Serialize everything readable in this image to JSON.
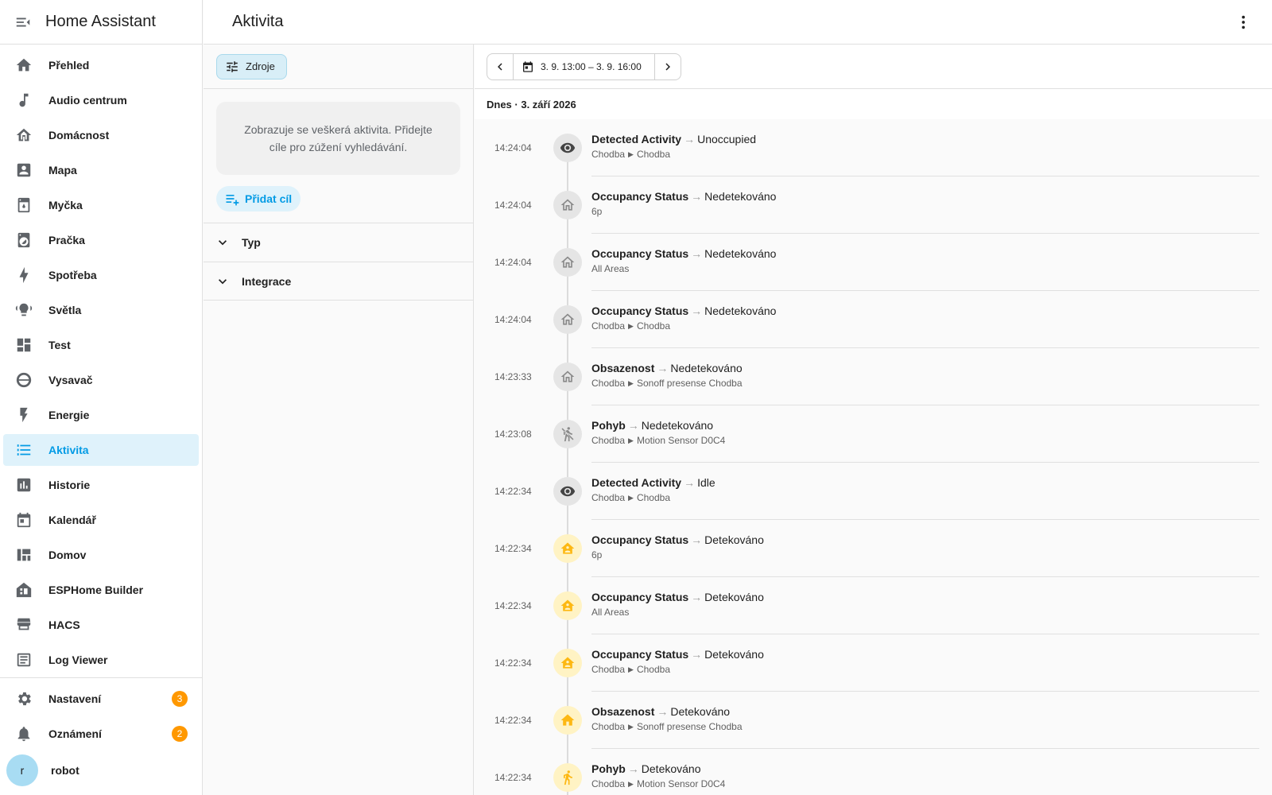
{
  "app": {
    "title": "Home Assistant"
  },
  "page": {
    "title": "Aktivita"
  },
  "sidebar": {
    "items": [
      {
        "label": "Přehled",
        "icon": "home-icon"
      },
      {
        "label": "Audio centrum",
        "icon": "music-note-icon"
      },
      {
        "label": "Domácnost",
        "icon": "home-group-icon"
      },
      {
        "label": "Mapa",
        "icon": "account-box-icon"
      },
      {
        "label": "Myčka",
        "icon": "dishwasher-icon"
      },
      {
        "label": "Pračka",
        "icon": "washing-machine-icon"
      },
      {
        "label": "Spotřeba",
        "icon": "lightning-icon"
      },
      {
        "label": "Světla",
        "icon": "lightbulb-group-icon"
      },
      {
        "label": "Test",
        "icon": "dashboard-icon"
      },
      {
        "label": "Vysavač",
        "icon": "robot-vacuum-icon"
      },
      {
        "label": "Energie",
        "icon": "flash-icon"
      },
      {
        "label": "Aktivita",
        "icon": "format-list-icon",
        "active": true
      },
      {
        "label": "Historie",
        "icon": "chart-box-icon"
      },
      {
        "label": "Kalendář",
        "icon": "calendar-icon"
      },
      {
        "label": "Domov",
        "icon": "view-dashboard-icon"
      },
      {
        "label": "ESPHome Builder",
        "icon": "esphome-icon"
      },
      {
        "label": "HACS",
        "icon": "hacs-icon"
      },
      {
        "label": "Log Viewer",
        "icon": "text-box-icon"
      }
    ],
    "bottom": [
      {
        "label": "Nastavení",
        "icon": "cog-icon",
        "badge": "3"
      },
      {
        "label": "Oznámení",
        "icon": "bell-icon",
        "badge": "2"
      }
    ],
    "user": {
      "initial": "r",
      "name": "robot"
    }
  },
  "filters": {
    "sources_label": "Zdroje",
    "info_text": "Zobrazuje se veškerá aktivita. Přidejte cíle pro zúžení vyhledávání.",
    "add_target_label": "Přidat cíl",
    "sections": [
      "Typ",
      "Integrace"
    ]
  },
  "logbook": {
    "date_range": "3. 9. 13:00 – 3. 9. 16:00",
    "day_header": "Dnes · 3. září 2026",
    "entries": [
      {
        "time": "14:24:04",
        "name": "Detected Activity",
        "state": "Unoccupied",
        "ctx": [
          "Chodba",
          "Chodba"
        ],
        "icon": "eye-icon",
        "style": "dark"
      },
      {
        "time": "14:24:04",
        "name": "Occupancy Status",
        "state": "Nedetekováno",
        "ctx": [
          "6p"
        ],
        "icon": "home-outline-icon",
        "style": "off"
      },
      {
        "time": "14:24:04",
        "name": "Occupancy Status",
        "state": "Nedetekováno",
        "ctx": [
          "All Areas"
        ],
        "icon": "home-outline-icon",
        "style": "off"
      },
      {
        "time": "14:24:04",
        "name": "Occupancy Status",
        "state": "Nedetekováno",
        "ctx": [
          "Chodba",
          "Chodba"
        ],
        "icon": "home-outline-icon",
        "style": "off"
      },
      {
        "time": "14:23:33",
        "name": "Obsazenost",
        "state": "Nedetekováno",
        "ctx": [
          "Chodba",
          "Sonoff presense Chodba"
        ],
        "icon": "home-outline-icon",
        "style": "off"
      },
      {
        "time": "14:23:08",
        "name": "Pohyb",
        "state": "Nedetekováno",
        "ctx": [
          "Chodba",
          "Motion Sensor D0C4"
        ],
        "icon": "walk-off-icon",
        "style": "off"
      },
      {
        "time": "14:22:34",
        "name": "Detected Activity",
        "state": "Idle",
        "ctx": [
          "Chodba",
          "Chodba"
        ],
        "icon": "eye-icon",
        "style": "dark"
      },
      {
        "time": "14:22:34",
        "name": "Occupancy Status",
        "state": "Detekováno",
        "ctx": [
          "6p"
        ],
        "icon": "home-account-icon",
        "style": "active"
      },
      {
        "time": "14:22:34",
        "name": "Occupancy Status",
        "state": "Detekováno",
        "ctx": [
          "All Areas"
        ],
        "icon": "home-account-icon",
        "style": "active"
      },
      {
        "time": "14:22:34",
        "name": "Occupancy Status",
        "state": "Detekováno",
        "ctx": [
          "Chodba",
          "Chodba"
        ],
        "icon": "home-account-icon",
        "style": "active"
      },
      {
        "time": "14:22:34",
        "name": "Obsazenost",
        "state": "Detekováno",
        "ctx": [
          "Chodba",
          "Sonoff presense Chodba"
        ],
        "icon": "home-icon",
        "style": "active"
      },
      {
        "time": "14:22:34",
        "name": "Pohyb",
        "state": "Detekováno",
        "ctx": [
          "Chodba",
          "Motion Sensor D0C4"
        ],
        "icon": "walk-icon",
        "style": "active"
      }
    ]
  },
  "colors": {
    "accent": "#039be5",
    "badge": "#ff9800",
    "active_state": "#fdb813"
  }
}
